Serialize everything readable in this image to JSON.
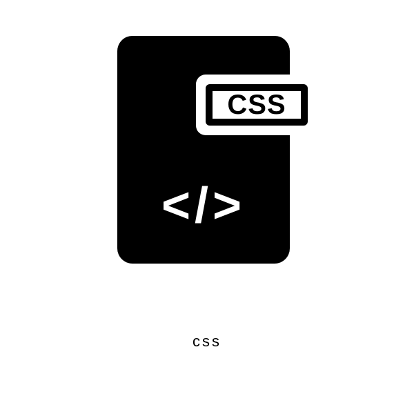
{
  "icon": {
    "badge_label": "CSS",
    "code_symbol": "</>"
  },
  "caption": "css"
}
